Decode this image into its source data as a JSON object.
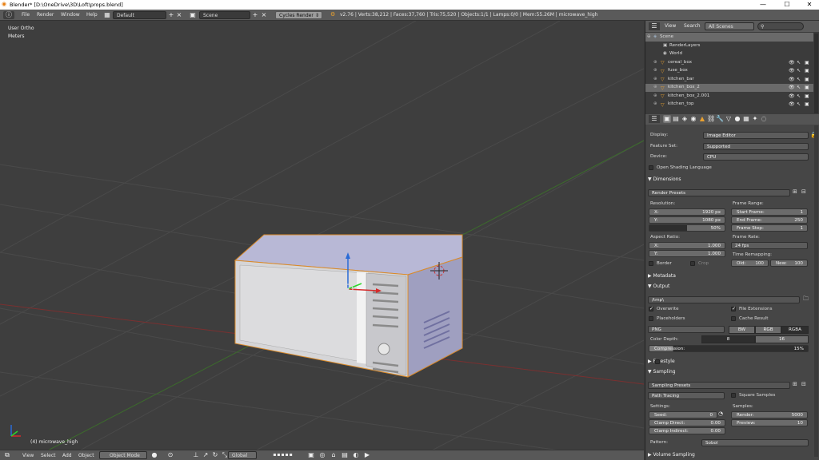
{
  "window": {
    "title": "Blender* [D:\\OneDrive\\3D\\Loft\\props.blend]",
    "min": "—",
    "max": "☐",
    "close": "✕"
  },
  "topbar": {
    "menus": [
      "File",
      "Render",
      "Window",
      "Help"
    ],
    "screen_layout": "Default",
    "scene": "Scene",
    "engine": "Cycles Render",
    "stats": "v2.76 | Verts:38,212 | Faces:37,760 | Tris:75,520 | Objects:1/1 | Lamps:0/0 | Mem:55.26M | microwave_high"
  },
  "viewport": {
    "view_name": "User Ortho",
    "units": "Meters",
    "object_label": "(4) microwave_high"
  },
  "bottombar": {
    "menus": [
      "View",
      "Select",
      "Add",
      "Object"
    ],
    "mode": "Object Mode",
    "orientation": "Global"
  },
  "outliner": {
    "menus": [
      "View",
      "Search"
    ],
    "filter": "All Scenes",
    "rows": [
      {
        "name": "Scene"
      },
      {
        "name": "RenderLayers"
      },
      {
        "name": "World"
      },
      {
        "name": "cereal_box"
      },
      {
        "name": "fuse_box"
      },
      {
        "name": "kitchen_bar"
      },
      {
        "name": "kitchen_box_2"
      },
      {
        "name": "kitchen_box_2.001"
      },
      {
        "name": "kitchen_top"
      }
    ]
  },
  "props": {
    "display_label": "Display:",
    "display_value": "Image Editor",
    "feature_label": "Feature Set:",
    "feature_value": "Supported",
    "device_label": "Device:",
    "device_value": "CPU",
    "osl": "Open Shading Language",
    "dimensions": "Dimensions",
    "render_presets": "Render Presets",
    "resolution": "Resolution:",
    "res_x_label": "X:",
    "res_x": "1920 px",
    "res_y_label": "Y:",
    "res_y": "1080 px",
    "res_pct": "50%",
    "frame_range": "Frame Range:",
    "start_label": "Start Frame:",
    "start": "1",
    "end_label": "End Frame:",
    "end": "250",
    "step_label": "Frame Step:",
    "step": "1",
    "aspect": "Aspect Ratio:",
    "asp_x_label": "X:",
    "asp_x": "1.000",
    "asp_y_label": "Y:",
    "asp_y": "1.000",
    "frame_rate": "Frame Rate:",
    "fps": "24 fps",
    "time_remap": "Time Remapping:",
    "old_label": "Old:",
    "old": "100",
    "new_label": "New:",
    "new": "100",
    "border": "Border",
    "crop": "Crop",
    "metadata": "Metadata",
    "output": "Output",
    "output_path": "/tmp\\",
    "overwrite": "Overwrite",
    "file_ext": "File Extensions",
    "placeholders": "Placeholders",
    "cache": "Cache Result",
    "format": "PNG",
    "bw": "BW",
    "rgb": "RGB",
    "rgba": "RGBA",
    "color_depth": "Color Depth:",
    "depth8": "8",
    "depth16": "16",
    "compression_label": "Compression:",
    "compression": "15%",
    "freestyle": "Freestyle",
    "sampling": "Sampling",
    "sampling_presets": "Sampling Presets",
    "integrator": "Path Tracing",
    "square_samples": "Square Samples",
    "settings": "Settings:",
    "seed_label": "Seed:",
    "seed": "0",
    "clamp_direct_label": "Clamp Direct:",
    "clamp_direct": "0.00",
    "clamp_indirect_label": "Clamp Indirect:",
    "clamp_indirect": "0.00",
    "samples": "Samples:",
    "render_label": "Render:",
    "render_samples": "5000",
    "preview_label": "Preview:",
    "preview_samples": "10",
    "pattern_label": "Pattern:",
    "pattern": "Sobol",
    "volume_sampling": "Volume Sampling"
  }
}
